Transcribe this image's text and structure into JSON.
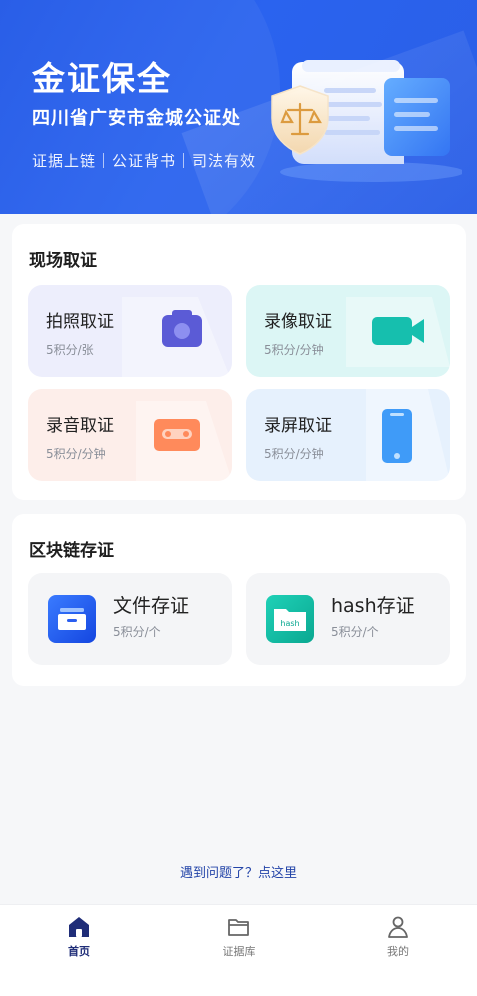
{
  "header": {
    "title": "金证保全",
    "subtitle": "四川省广安市金城公证处",
    "tags": "证据上链｜公证背书｜司法有效"
  },
  "scene": {
    "title": "现场取证",
    "items": [
      {
        "name": "拍照取证",
        "cost": "5积分/张",
        "icon": "camera-icon"
      },
      {
        "name": "录像取证",
        "cost": "5积分/分钟",
        "icon": "video-camera-icon"
      },
      {
        "name": "录音取证",
        "cost": "5积分/分钟",
        "icon": "cassette-icon"
      },
      {
        "name": "录屏取证",
        "cost": "5积分/分钟",
        "icon": "phone-screen-icon"
      }
    ]
  },
  "chain": {
    "title": "区块链存证",
    "items": [
      {
        "name": "文件存证",
        "cost": "5积分/个",
        "icon": "file-box-icon"
      },
      {
        "name": "hash存证",
        "cost": "5积分/个",
        "icon": "hash-folder-icon",
        "icon_text": "hash"
      }
    ]
  },
  "help_link": "遇到问题了？点这里",
  "tabbar": [
    {
      "label": "首页",
      "icon": "home-icon",
      "active": true
    },
    {
      "label": "证据库",
      "icon": "folder-icon",
      "active": false
    },
    {
      "label": "我的",
      "icon": "user-icon",
      "active": false
    }
  ],
  "colors": {
    "brand": "#2a63ef",
    "tab_active": "#1f2d78",
    "help_link": "#2344a8"
  }
}
